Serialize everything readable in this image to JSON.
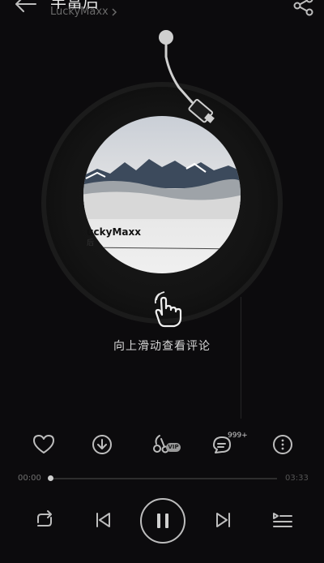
{
  "header": {
    "title": "丰富后",
    "artist": "LuckyMaxx"
  },
  "record": {
    "cover_text": "uckyMaxx",
    "cover_subtext": "后"
  },
  "hint": {
    "text": "向上滑动查看评论"
  },
  "actions": {
    "vip_badge": "VIP",
    "comment_count": "999+"
  },
  "progress": {
    "current": "00:00",
    "total": "03:33",
    "fraction": 0.0
  },
  "icons": {
    "back": "back-arrow-icon",
    "share": "share-icon",
    "like": "heart-icon",
    "download": "download-icon",
    "vip_sound": "vip-sound-effect-icon",
    "comment": "comment-icon",
    "more": "more-icon",
    "repeat": "repeat-icon",
    "prev": "previous-icon",
    "pause": "pause-icon",
    "next": "next-icon",
    "queue": "playlist-icon",
    "hand": "swipe-hand-icon"
  },
  "colors": {
    "background": "#0c0b0d",
    "icon": "#bdbdbd"
  }
}
